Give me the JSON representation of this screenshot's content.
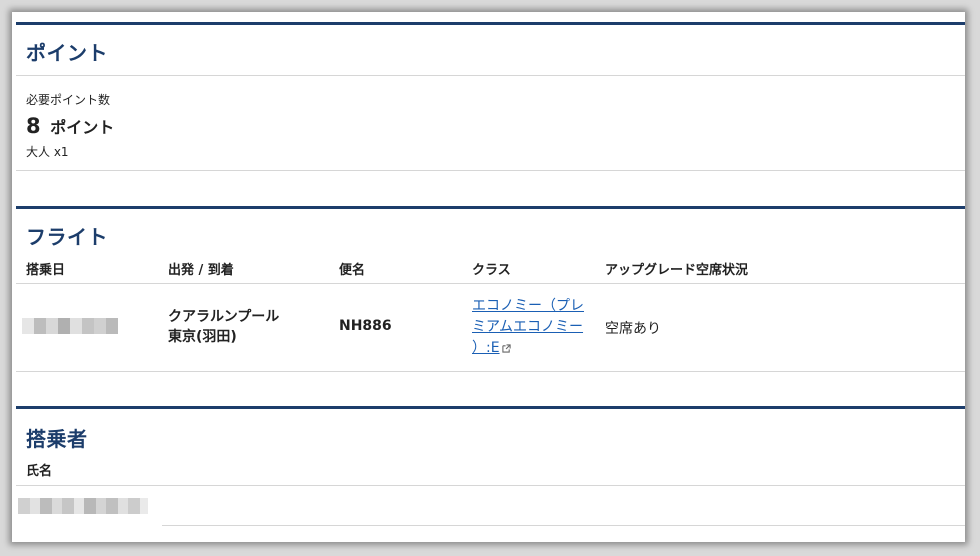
{
  "points": {
    "title": "ポイント",
    "required_label": "必要ポイント数",
    "value": "8",
    "unit": "ポイント",
    "passenger_count": "大人 x1"
  },
  "flight": {
    "title": "フライト",
    "headers": {
      "date": "搭乗日",
      "route": "出発 / 到着",
      "flight_no": "便名",
      "class": "クラス",
      "upgrade": "アップグレード空席状況"
    },
    "row": {
      "date": "",
      "departure": "クアラルンプール",
      "arrival": "東京(羽田)",
      "flight_no": "NH886",
      "class_line1": "エコノミー（プレ",
      "class_line2": "ミアムエコノミー",
      "class_line3": "）:E",
      "upgrade_status": "空席あり"
    }
  },
  "passengers": {
    "title": "搭乗者",
    "name_header": "氏名",
    "name": ""
  },
  "colors": {
    "accent": "#1c3d6b",
    "link": "#1a5fb4"
  }
}
